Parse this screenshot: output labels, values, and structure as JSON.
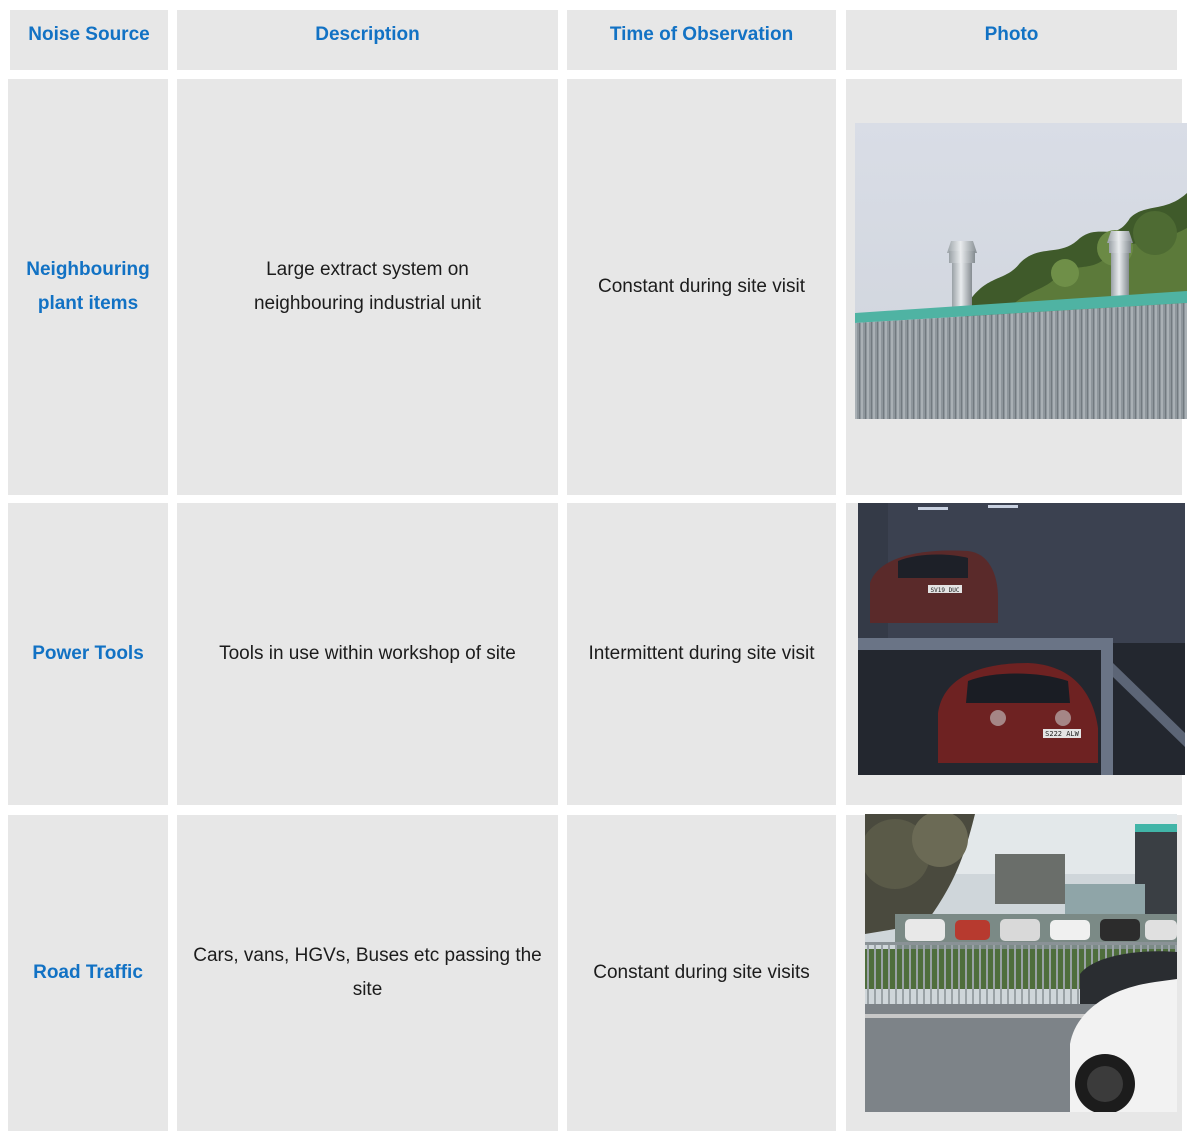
{
  "table": {
    "headers": [
      "Noise Source",
      "Description",
      "Time of Observation",
      "Photo"
    ],
    "rows": [
      {
        "source": "Neighbouring plant items",
        "description": "Large extract system on neighbouring industrial unit",
        "time": "Constant during site visit",
        "photo_icon": "rooftop-extract-photo"
      },
      {
        "source": "Power Tools",
        "description": "Tools in use within workshop of site",
        "time": "Intermittent during site visit",
        "photo_icon": "workshop-cars-photo",
        "plates": [
          "SV19 DUC",
          "S222 ALW"
        ]
      },
      {
        "source": "Road Traffic",
        "description": "Cars, vans, HGVs, Buses etc passing the site",
        "time": "Constant during site visits",
        "photo_icon": "road-traffic-photo"
      }
    ]
  },
  "colors": {
    "cell_bg": "#e7e7e7",
    "header_text": "#1272c4",
    "body_text": "#1c1c1c"
  }
}
